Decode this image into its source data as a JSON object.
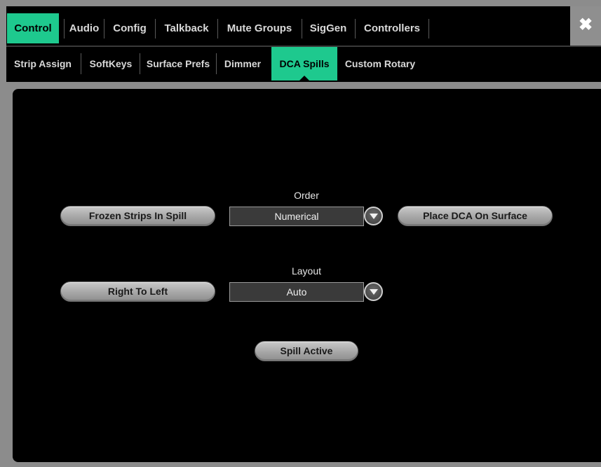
{
  "top_tabs": [
    "Control",
    "Audio",
    "Config",
    "Talkback",
    "Mute Groups",
    "SigGen",
    "Controllers"
  ],
  "active_top_tab": "Control",
  "sub_tabs": [
    "Strip Assign",
    "SoftKeys",
    "Surface Prefs",
    "Dimmer",
    "DCA Spills",
    "Custom Rotary"
  ],
  "active_sub_tab": "DCA Spills",
  "close_icon": "✖",
  "panel": {
    "frozen_strips_label": "Frozen Strips In Spill",
    "order_caption": "Order",
    "order_value": "Numerical",
    "place_dca_label": "Place DCA On Surface",
    "right_to_left_label": "Right To Left",
    "layout_caption": "Layout",
    "layout_value": "Auto",
    "spill_active_label": "Spill Active"
  },
  "colors": {
    "accent": "#1ec98e",
    "background": "#000000",
    "frame": "#8c8c8c"
  }
}
